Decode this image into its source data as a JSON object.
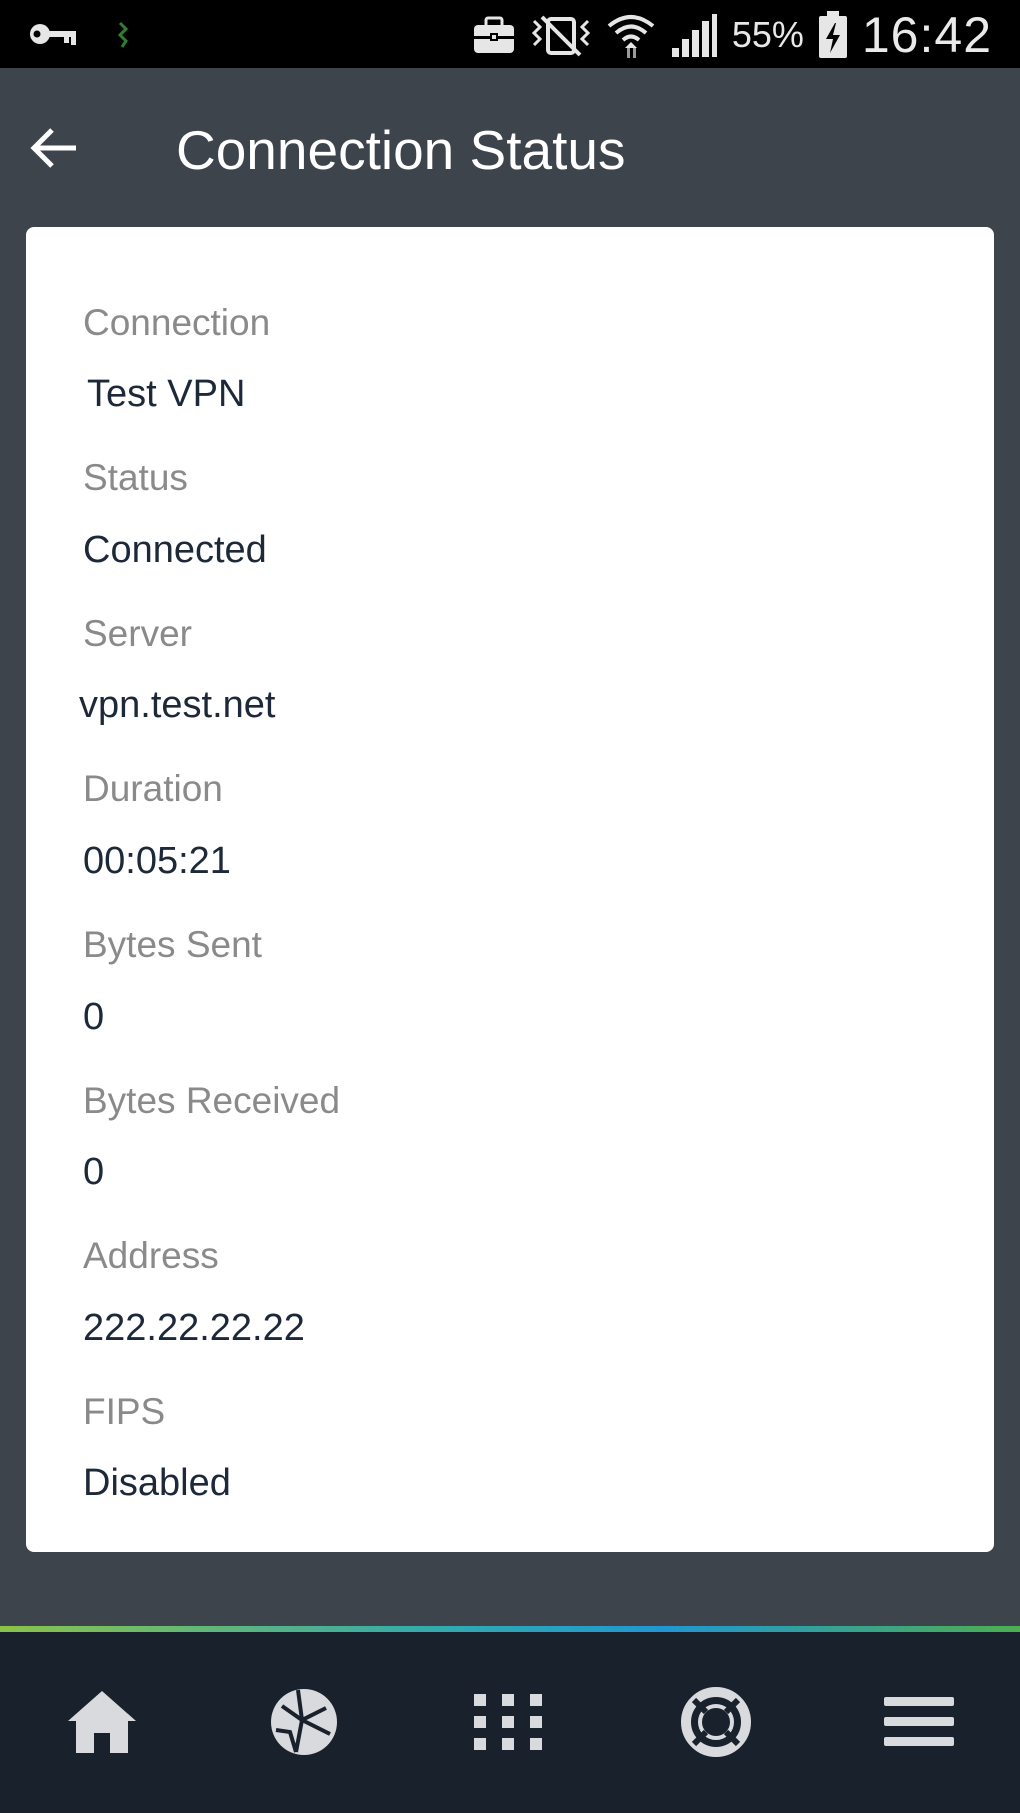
{
  "status_bar": {
    "battery_percent": "55%",
    "time": "16:42",
    "icons": [
      "key-icon",
      "notification-icon",
      "briefcase-icon",
      "vibrate-icon",
      "wifi-icon",
      "signal-icon",
      "battery-charging-icon"
    ]
  },
  "app_bar": {
    "title": "Connection Status",
    "back_icon": "back-arrow-icon"
  },
  "details": [
    {
      "label": "Connection",
      "value": "Test VPN"
    },
    {
      "label": "Status",
      "value": "Connected"
    },
    {
      "label": "Server",
      "value": "vpn.test.net"
    },
    {
      "label": "Duration",
      "value": "00:05:21"
    },
    {
      "label": "Bytes Sent",
      "value": "0"
    },
    {
      "label": "Bytes Received",
      "value": "0"
    },
    {
      "label": "Address",
      "value": "222.22.22.22"
    },
    {
      "label": "FIPS",
      "value": "Disabled"
    }
  ],
  "bottom_nav": {
    "items": [
      "home-icon",
      "globe-icon",
      "apps-grid-icon",
      "help-lifebuoy-icon",
      "menu-icon"
    ]
  },
  "colors": {
    "background": "#3e444c",
    "status_bar": "#000000",
    "card": "#ffffff",
    "label": "#8a8a8a",
    "value": "#1d2838",
    "bottom_nav": "#19212c",
    "nav_icon": "#d8dade"
  }
}
